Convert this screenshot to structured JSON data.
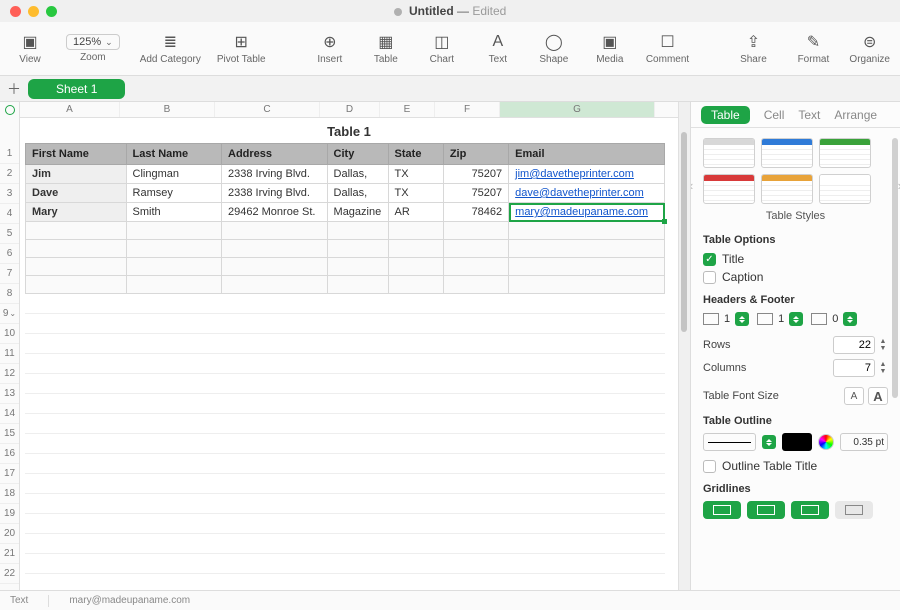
{
  "window": {
    "title": "Untitled",
    "status": "Edited"
  },
  "toolbar": {
    "view": "View",
    "zoom_value": "125%",
    "zoom_label": "Zoom",
    "add_category": "Add Category",
    "pivot": "Pivot Table",
    "insert": "Insert",
    "table": "Table",
    "chart": "Chart",
    "text": "Text",
    "shape": "Shape",
    "media": "Media",
    "comment": "Comment",
    "share": "Share",
    "format": "Format",
    "organize": "Organize"
  },
  "sheet_tab": "Sheet 1",
  "columns": [
    "A",
    "B",
    "C",
    "D",
    "E",
    "F",
    "G"
  ],
  "selected_col": "G",
  "row_headers": [
    1,
    2,
    3,
    4,
    5,
    6,
    7,
    8,
    9,
    10,
    11,
    12,
    13,
    14,
    15,
    16,
    17,
    18,
    19,
    20,
    21,
    22
  ],
  "stepper_row": 9,
  "table_title": "Table 1",
  "headers": [
    "First Name",
    "Last Name",
    "Address",
    "City",
    "State",
    "Zip",
    "Email"
  ],
  "rows": [
    {
      "first": "Jim",
      "last": "Clingman",
      "address": "2338 Irving Blvd.",
      "city": "Dallas,",
      "state": "TX",
      "zip": "75207",
      "email": "jim@davetheprinter.com"
    },
    {
      "first": "Dave",
      "last": "Ramsey",
      "address": "2338 Irving Blvd.",
      "city": "Dallas,",
      "state": "TX",
      "zip": "75207",
      "email": "dave@davetheprinter.com"
    },
    {
      "first": "Mary",
      "last": "Smith",
      "address": "29462 Monroe St.",
      "city": "Magazine",
      "state": "AR",
      "zip": "78462",
      "email": "mary@madeupaname.com"
    }
  ],
  "selected_cell_value": "mary@madeupaname.com",
  "inspector": {
    "tabs": [
      "Table",
      "Cell",
      "Text",
      "Arrange"
    ],
    "active_tab": "Table",
    "styles_caption": "Table Styles",
    "style_colors": [
      "#d8d8d8",
      "#2f7bd8",
      "#3aa23a",
      "#d83a3a",
      "#e8a33a",
      "#ffffff"
    ],
    "options_title": "Table Options",
    "title_checkbox": "Title",
    "title_checked": true,
    "caption_checkbox": "Caption",
    "caption_checked": false,
    "hf_title": "Headers & Footer",
    "hf_values": [
      1,
      1,
      0
    ],
    "rows_label": "Rows",
    "rows_value": 22,
    "cols_label": "Columns",
    "cols_value": 7,
    "font_size_label": "Table Font Size",
    "outline_label": "Table Outline",
    "outline_pt": "0.35 pt",
    "outline_title_checkbox": "Outline Table Title",
    "outline_title_checked": false,
    "gridlines_label": "Gridlines"
  },
  "status_bar": {
    "label": "Text",
    "value": "mary@madeupaname.com"
  }
}
